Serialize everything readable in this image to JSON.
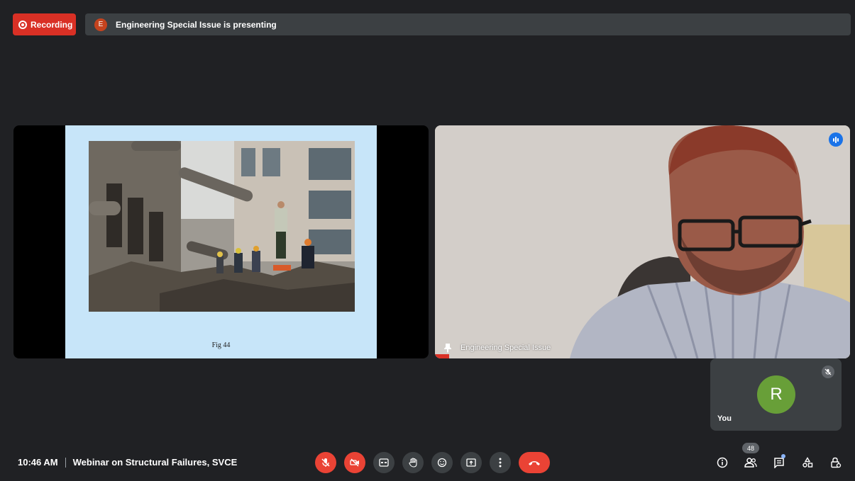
{
  "recording": {
    "label": "Recording"
  },
  "presenter": {
    "avatar_letter": "E",
    "status_text": "Engineering Special Issue is presenting"
  },
  "slide": {
    "caption": "Fig 44"
  },
  "speaker": {
    "name": "Engineering Special Issue"
  },
  "self_tile": {
    "avatar_letter": "R",
    "label": "You"
  },
  "meeting": {
    "time": "10:46 AM",
    "title": "Webinar on Structural Failures, SVCE"
  },
  "people": {
    "count": "48"
  },
  "colors": {
    "recording": "#d93025",
    "avatar_self": "#689f38",
    "avatar_presenter": "#c5431e",
    "end_call": "#ea4335",
    "accent": "#1a73e8",
    "background": "#202124",
    "control": "#3c4043"
  }
}
